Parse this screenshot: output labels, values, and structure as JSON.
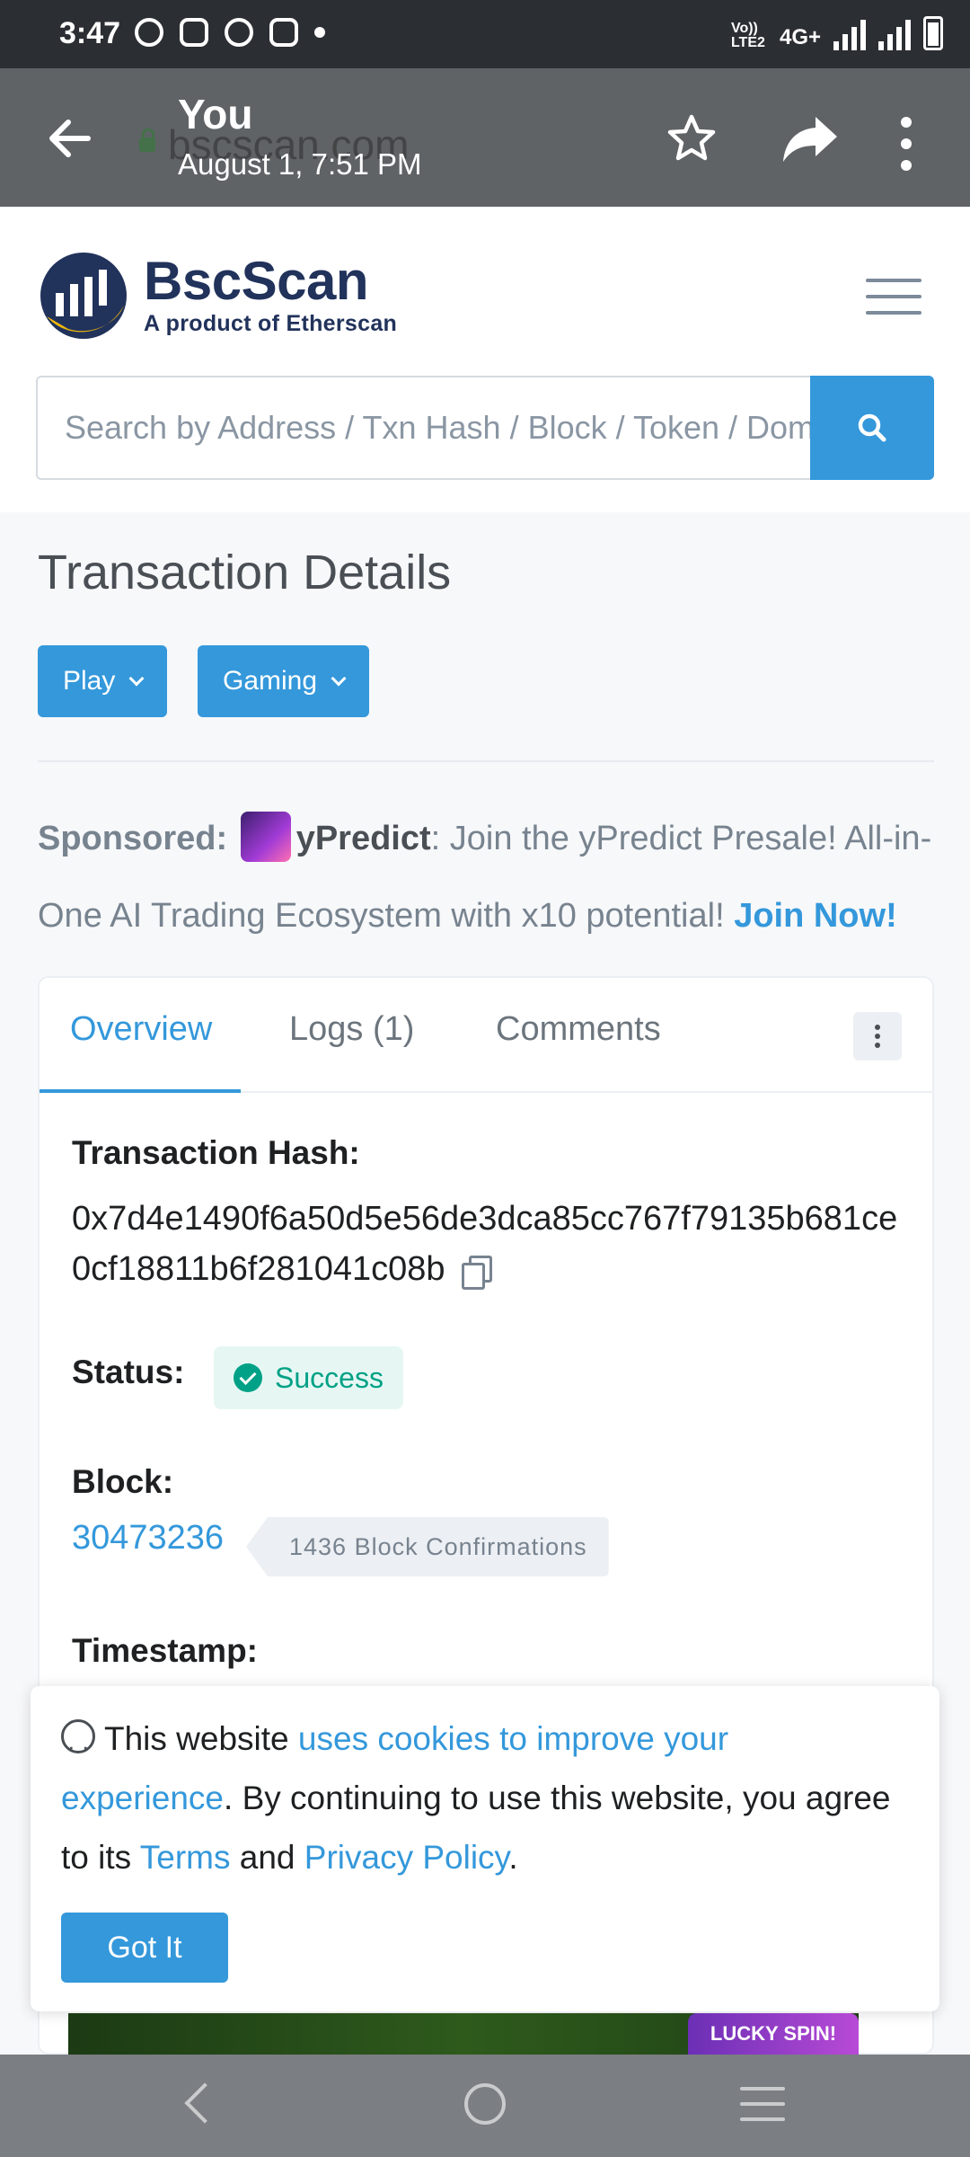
{
  "status_bar": {
    "time": "3:47",
    "network": "4G+",
    "volte": "Vo)) LTE2"
  },
  "app_bar": {
    "title": "You",
    "subtitle": "August 1, 7:51 PM",
    "url": "bscscan.com"
  },
  "header": {
    "logo_name": "BscScan",
    "logo_sub": "A product of Etherscan",
    "search_placeholder": "Search by Address / Txn Hash / Block / Token / Domain Name"
  },
  "page": {
    "title": "Transaction Details",
    "buttons": [
      {
        "label": "Play"
      },
      {
        "label": "Gaming"
      }
    ]
  },
  "sponsor": {
    "label": "Sponsored:",
    "name": "yPredict",
    "text": ": Join the yPredict Presale! All-in-One AI Trading Ecosystem with x10 potential!",
    "cta": "Join Now!"
  },
  "tabs": [
    {
      "label": "Overview",
      "active": true
    },
    {
      "label": "Logs (1)",
      "active": false
    },
    {
      "label": "Comments",
      "active": false
    }
  ],
  "details": {
    "hash_label": "Transaction Hash:",
    "hash_value": "0x7d4e1490f6a50d5e56de3dca85cc767f79135b681ce0cf18811b6f281041c08b",
    "status_label": "Status:",
    "status_value": "Success",
    "block_label": "Block:",
    "block_value": "30473236",
    "confirmations": "1436 Block Confirmations",
    "timestamp_label": "Timestamp:"
  },
  "cookie": {
    "t1": "This website ",
    "link1": "uses cookies to improve your experience",
    "t2": ". By continuing to use this website, you agree to its ",
    "link2": "Terms",
    "t3": " and ",
    "link3": "Privacy Policy",
    "t4": ".",
    "button": "Got It"
  },
  "ad": {
    "badge": "LUCKY SPIN!"
  },
  "colors": {
    "accent": "#3498db",
    "success": "#00a186",
    "brand_dark": "#21325b",
    "brand_yellow": "#f0b90b"
  }
}
